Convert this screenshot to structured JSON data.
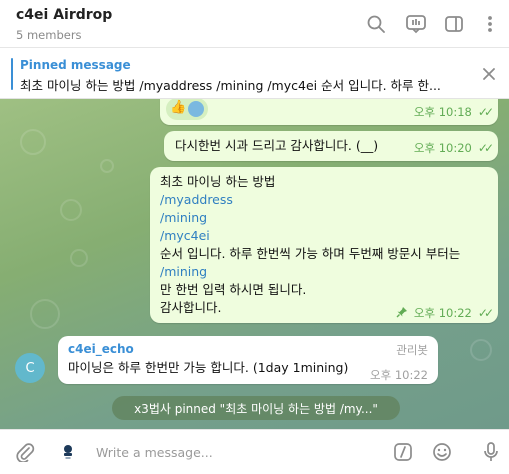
{
  "header": {
    "title": "c4ei Airdrop",
    "subtitle": "5 members"
  },
  "pinned": {
    "label": "Pinned message",
    "text": "최초 마이닝 하는 방법 /myaddress /mining /myc4ei 순서 입니다. 하루 한..."
  },
  "messages": {
    "m1": {
      "time": "오후 10:18",
      "reaction_emoji": "👍"
    },
    "m2": {
      "text": "다시한번 시과 드리고 감사합니다. (__)",
      "time": "오후 10:20"
    },
    "m3": {
      "line1": "최초 마이닝 하는 방법",
      "cmd1": "/myaddress",
      "cmd2": "/mining",
      "cmd3": "/myc4ei",
      "line2": "순서 입니다. 하루 한번씩 가능 하며 두번째 방문시 부터는",
      "cmd4": "/mining",
      "line3": "만 한번 입력 하시면 됩니다.",
      "line4": "감사합니다.",
      "time": "오후 10:22"
    },
    "m4": {
      "avatar_letter": "C",
      "sender": "c4ei_echo",
      "role": "관리봇",
      "text": "마이닝은 하루 한번만 가능 합니다. (1day 1mining)",
      "time": "오후 10:22"
    }
  },
  "service_message": "x3법사 pinned \"최초 마이닝 하는 방법 /my...\"",
  "footer": {
    "placeholder": "Write a message..."
  },
  "colors": {
    "accent": "#3a8fd6",
    "outgoing_bubble": "#effdde",
    "check_green": "#62ac55",
    "avatar": "#62b8cc"
  }
}
